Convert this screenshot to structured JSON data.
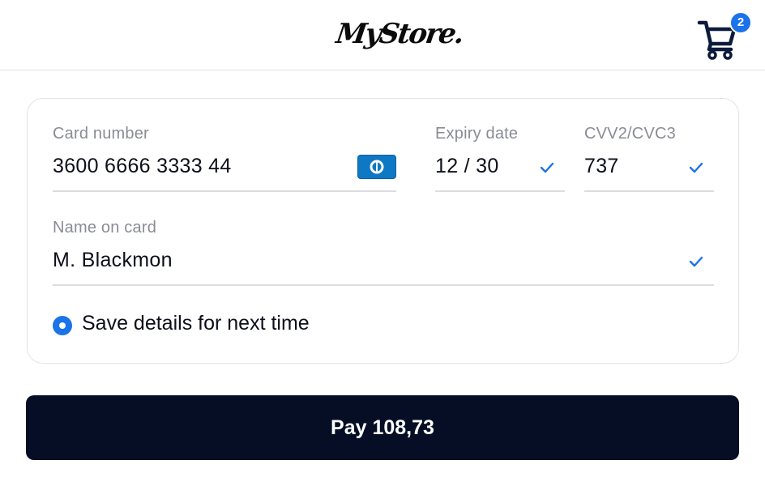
{
  "header": {
    "logo_text": "MyStore.",
    "cart_count": "2",
    "cart_icon": "shopping-cart-icon"
  },
  "payment_form": {
    "card_number": {
      "label": "Card number",
      "value": "3600 6666 3333 44",
      "brand_icon": "diners-club-card-icon"
    },
    "expiry": {
      "label": "Expiry date",
      "value": "12 / 30",
      "valid": true
    },
    "cvv": {
      "label": "CVV2/CVC3",
      "value": "737",
      "valid": true
    },
    "name": {
      "label": "Name on card",
      "value": "M. Blackmon",
      "valid": true
    },
    "save_details": {
      "label": "Save details for next time",
      "checked": true
    }
  },
  "pay_button": {
    "label": "Pay 108,73"
  },
  "colors": {
    "accent": "#1a73e8",
    "button_bg": "#050e25",
    "label_gray": "#8a8c94",
    "card_brand_blue": "#0f78c4"
  }
}
